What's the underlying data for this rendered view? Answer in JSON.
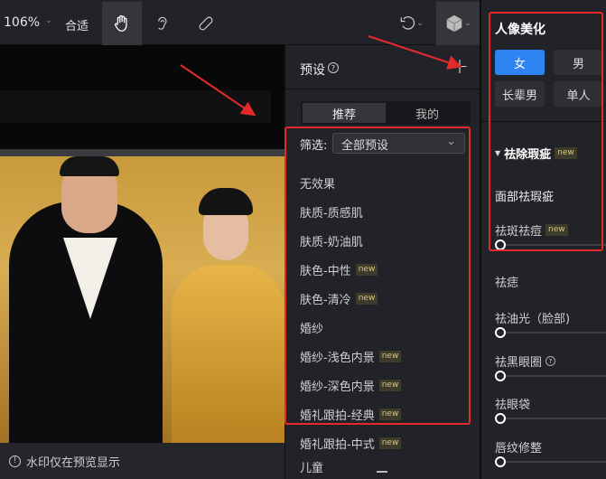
{
  "toolbar": {
    "zoom": "106%",
    "fit_label": "合适",
    "tools": [
      "hand-icon",
      "ear-icon",
      "bandage-icon"
    ],
    "undo_icon": "undo-icon",
    "model_icon": "cube-icon"
  },
  "canvas": {
    "watermark_notice": "水印仅在预览显示"
  },
  "preset": {
    "title": "预设",
    "tabs": [
      "推荐",
      "我的"
    ],
    "filter_label": "筛选:",
    "filter_value": "全部预设",
    "items": [
      {
        "label": "无效果",
        "new": ""
      },
      {
        "label": "肤质-质感肌",
        "new": ""
      },
      {
        "label": "肤质-奶油肌",
        "new": ""
      },
      {
        "label": "肤色-中性",
        "new": "new"
      },
      {
        "label": "肤色-清冷",
        "new": "new"
      },
      {
        "label": "婚纱",
        "new": ""
      },
      {
        "label": "婚纱-浅色内景",
        "new": "new"
      },
      {
        "label": "婚纱-深色内景",
        "new": "new"
      },
      {
        "label": "婚礼跟拍-经典",
        "new": "new"
      },
      {
        "label": "婚礼跟拍-中式",
        "new": "new"
      },
      {
        "label": "儿童",
        "new": ""
      }
    ]
  },
  "right": {
    "title": "人像美化",
    "genders": [
      "女",
      "男",
      "长辈男",
      "单人"
    ],
    "section": "祛除瑕疵",
    "section_badge": "new",
    "subsection": "面部祛瑕疵",
    "sliders": [
      {
        "label": "祛斑祛痘",
        "badge": "new",
        "value": 0
      },
      {
        "label": "祛痣",
        "badge": "",
        "value": null
      },
      {
        "label": "祛油光（脸部)",
        "badge": "",
        "value": 0
      },
      {
        "label": "祛黑眼圈",
        "badge": "",
        "value": 0
      },
      {
        "label": "祛眼袋",
        "badge": "",
        "value": 0
      },
      {
        "label": "唇纹修整",
        "badge": "",
        "value": 0
      }
    ]
  },
  "colors": {
    "accent": "#2f84f4",
    "annotation": "#e22a2a"
  }
}
